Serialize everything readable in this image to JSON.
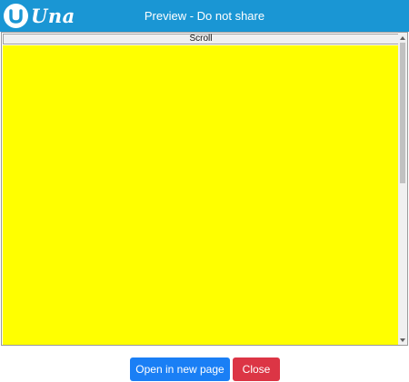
{
  "window": {
    "title": "Preview - Do not share"
  },
  "logo": {
    "text": "Una",
    "icon": "una-logo-icon"
  },
  "preview": {
    "scroll_label": "Scroll",
    "background_color": "#ffff00"
  },
  "footer": {
    "open_label": "Open in new page",
    "close_label": "Close"
  },
  "colors": {
    "header": "#1a96d4",
    "primary": "#1a7ff5",
    "danger": "#dc3545"
  }
}
